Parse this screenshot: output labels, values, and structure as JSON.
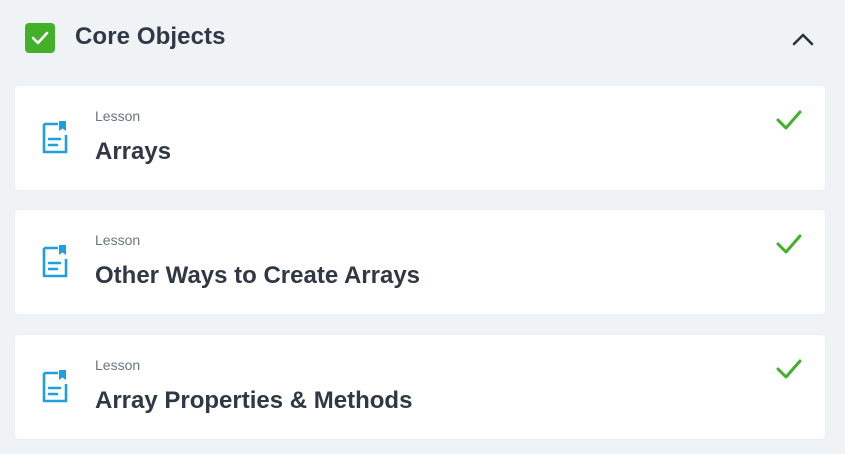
{
  "section": {
    "title": "Core Objects",
    "completed": true
  },
  "colors": {
    "accent_green": "#43b02a",
    "icon_blue": "#1f9fe0",
    "background": "#f0f3f6"
  },
  "icons": {
    "header_check": "checkbox-checked-icon",
    "collapse": "chevron-up-icon",
    "lesson": "lesson-document-icon",
    "complete": "checkmark-icon"
  },
  "lessons": [
    {
      "type_label": "Lesson",
      "title": "Arrays",
      "completed": true
    },
    {
      "type_label": "Lesson",
      "title": "Other Ways to Create Arrays",
      "completed": true
    },
    {
      "type_label": "Lesson",
      "title": "Array Properties & Methods",
      "completed": true
    }
  ]
}
